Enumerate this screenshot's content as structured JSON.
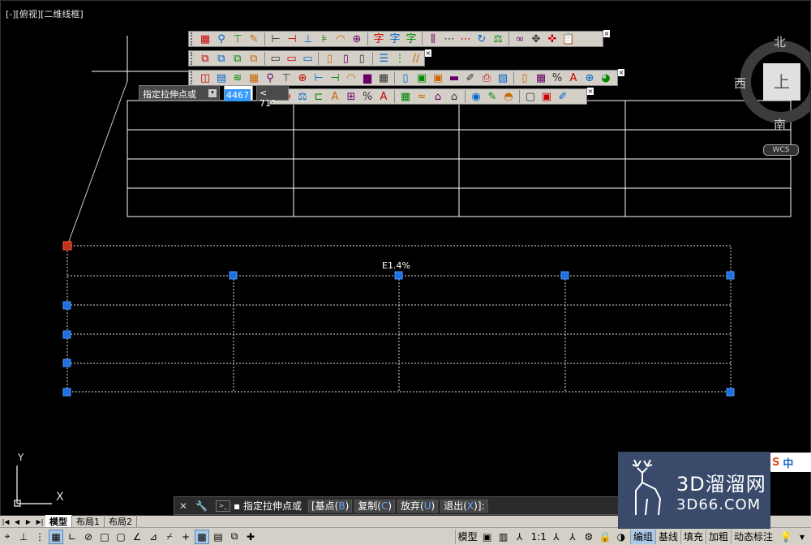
{
  "viewport": {
    "label": "[-][俯视][二维线框]"
  },
  "viewcube": {
    "north": "北",
    "west": "西",
    "south": "南",
    "top": "上",
    "wcs": "WCS"
  },
  "ucs": {
    "y": "Y",
    "x": "X"
  },
  "grip_prompt": {
    "text": "指定拉伸点或",
    "length": "4467",
    "angle": "< 71°"
  },
  "table_title": "E1.4%",
  "toolbars": [
    {
      "icons": [
        "grid-icon",
        "node-icon",
        "tree-icon",
        "edit-icon",
        "sep",
        "dim-linear-icon",
        "dim-aligned-icon",
        "dim-baseline-icon",
        "dim-continue-icon",
        "arc-icon",
        "center-icon",
        "sep",
        "text-edit-icon",
        "text-style-icon",
        "text-find-icon",
        "sep",
        "hatch-icon",
        "array-icon",
        "array-icon-2",
        "rotate-icon",
        "measure-icon",
        "sep",
        "link-icon",
        "move-icon",
        "pan-icon",
        "paste-icon"
      ]
    },
    {
      "icons": [
        "copy-icon",
        "copy-icon-2",
        "copy-icon-3",
        "copy-icon-4",
        "sep",
        "row-icon",
        "row-icon-2",
        "row-icon-3",
        "sep",
        "col-icon",
        "col-icon-2",
        "col-icon-3",
        "sep",
        "list-icon",
        "list-icon-2",
        "slash-icon"
      ]
    },
    {
      "icons": [
        "layer-icon",
        "property-icon",
        "match-icon",
        "grid-icon",
        "node-icon",
        "tree-icon",
        "center-icon",
        "dim-linear-icon",
        "dim-aligned-icon",
        "arc-icon",
        "chart-icon",
        "table-icon",
        "sep",
        "col-icon",
        "window-icon",
        "window-icon-2",
        "image-icon",
        "brush-icon",
        "print-icon",
        "plot-icon",
        "sep",
        "text-icon",
        "cell-icon",
        "number-icon",
        "text-a-icon",
        "target-icon",
        "globe-icon"
      ]
    },
    {
      "icons": [
        "arrow-icon",
        "measure-icon",
        "field-icon",
        "text-a-icon",
        "style-icon",
        "number-icon",
        "label-icon",
        "sep",
        "table-icon",
        "wave-icon",
        "base-icon",
        "house-icon",
        "sep",
        "eye-icon",
        "note-icon",
        "render-icon",
        "sep",
        "frame-icon",
        "frame-icon-2",
        "brush-icon"
      ]
    }
  ],
  "command_line": {
    "label": "指定拉伸点或",
    "options": [
      {
        "text": "[基点(",
        "key": "B",
        "end": ")"
      },
      {
        "text": "复制(",
        "key": "C",
        "end": ")"
      },
      {
        "text": "放弃(",
        "key": "U",
        "end": ")"
      },
      {
        "text": "退出(",
        "key": "X",
        "end": ")]:"
      }
    ]
  },
  "layout_tabs": [
    "模型",
    "布局1",
    "布局2"
  ],
  "status": {
    "model": "模型",
    "scale": "1:1",
    "toggles": [
      "编组",
      "基线",
      "填充",
      "加粗",
      "动态标注"
    ]
  },
  "brand": {
    "line1": "3D溜溜网",
    "line2": "3D66.COM"
  },
  "ime": {
    "mode": "中"
  }
}
